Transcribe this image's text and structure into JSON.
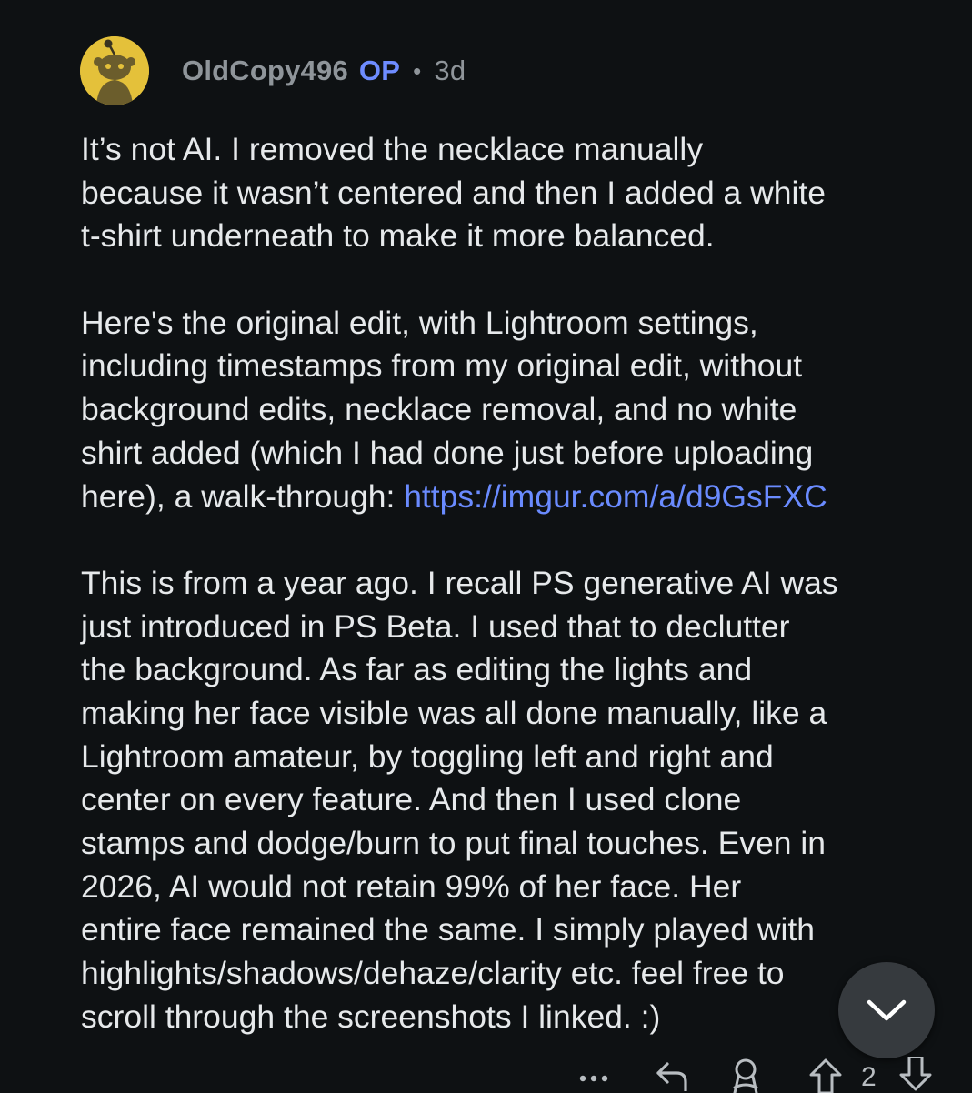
{
  "comment": {
    "author": "OldCopy496",
    "op_badge": "OP",
    "separator": "•",
    "age": "3d",
    "paragraphs": [
      {
        "lines": [
          "It’s not AI. I removed the necklace manually",
          "because it wasn’t centered and then I added a white",
          "t-shirt underneath to make it more balanced."
        ]
      },
      {
        "lines": [
          "Here's the original edit, with Lightroom settings,",
          "including timestamps from my original edit, without",
          "background edits, necklace removal, and no white",
          "shirt added (which I had done just before uploading"
        ],
        "last_line_prefix": "here), a walk-through: ",
        "link": "https://imgur.com/a/d9GsFXC"
      },
      {
        "lines": [
          "This is from a year ago. I recall PS generative AI was",
          "just introduced in PS Beta. I used that to declutter",
          "the background. As far as editing the lights and",
          "making her face visible was all done manually, like a",
          "Lightroom amateur, by toggling left and right and",
          "center on every feature. And then I used clone",
          "stamps and dodge/burn to put final touches. Even in",
          "2026, AI would not retain 99% of her face. Her",
          "entire face remained the same. I simply played with",
          "highlights/shadows/dehaze/clarity etc. feel free to",
          "scroll through the screenshots I linked. :)"
        ]
      }
    ],
    "vote_count": "2"
  },
  "icons": {
    "avatar": "snoo-avatar",
    "scroll_down": "chevron-down-icon",
    "more": "more-icon",
    "reply": "reply-icon",
    "award": "award-icon",
    "upvote": "upvote-icon",
    "downvote": "downvote-icon"
  },
  "colors": {
    "background": "#0e1113",
    "text": "#e6e9eb",
    "meta": "#8f959a",
    "op": "#6e8cff",
    "link": "#6a8bff",
    "avatar": "#e4c13a",
    "scroll_button": "#363a3e"
  }
}
